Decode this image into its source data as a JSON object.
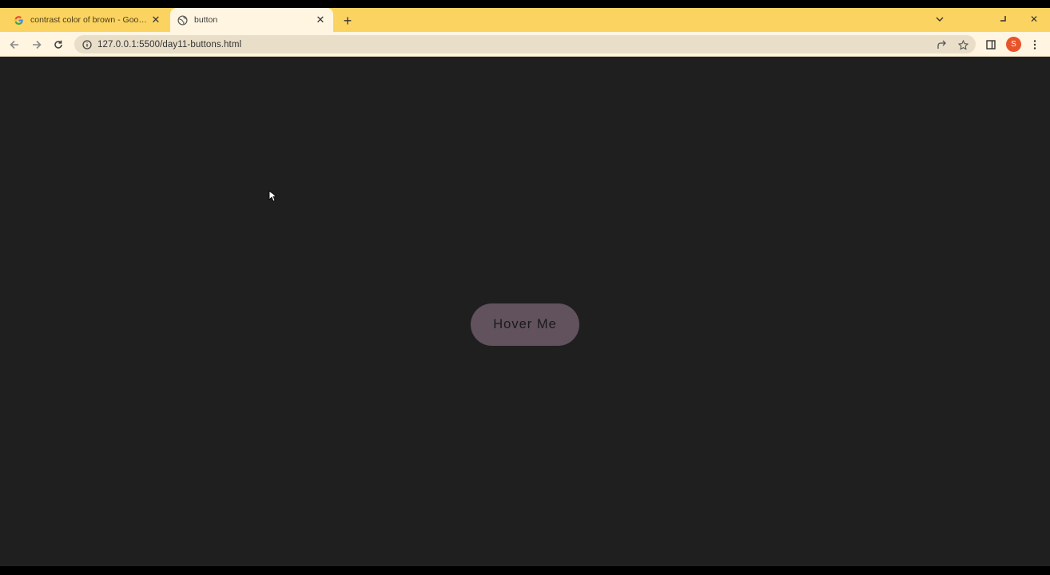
{
  "browser": {
    "tabs": [
      {
        "title": "contrast color of brown - Google",
        "favicon": "google-icon",
        "active": false
      },
      {
        "title": "button",
        "favicon": "globe-icon",
        "active": true
      }
    ],
    "new_tab_label": "+",
    "address_bar": {
      "url": "127.0.0.1:5500/day11-buttons.html"
    },
    "profile_initial": "S",
    "colors": {
      "tabstrip": "#fbd360",
      "toolbar": "#fff5e1",
      "omnibox": "#e9dfc9",
      "avatar": "#e8542a"
    }
  },
  "page": {
    "background": "#1f1f1f",
    "button": {
      "label": "Hover Me",
      "color": "#61525d"
    }
  }
}
